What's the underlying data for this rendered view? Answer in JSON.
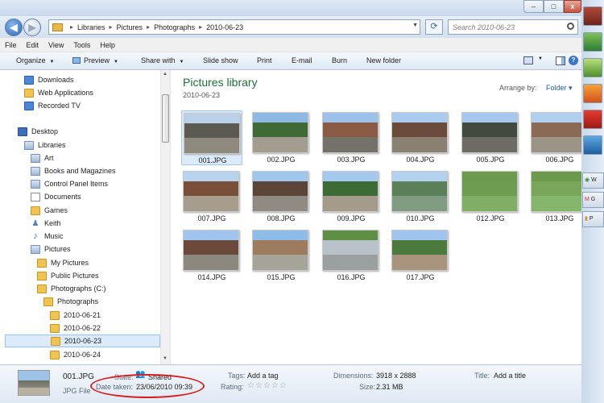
{
  "window": {
    "minimize": "–",
    "maximize": "□",
    "close": "x"
  },
  "address": {
    "crumbs": [
      "Libraries",
      "Pictures",
      "Photographs",
      "2010-06-23"
    ],
    "search_placeholder": "Search 2010-06-23"
  },
  "menu": [
    "File",
    "Edit",
    "View",
    "Tools",
    "Help"
  ],
  "toolbar": {
    "organize": "Organize",
    "preview": "Preview",
    "share_with": "Share with",
    "slide_show": "Slide show",
    "print": "Print",
    "email": "E-mail",
    "burn": "Burn",
    "new_folder": "New folder"
  },
  "nav": [
    {
      "label": "Downloads",
      "icon": "downloads-icon",
      "indent": 1
    },
    {
      "label": "Web Applications",
      "icon": "folder-icon",
      "indent": 1
    },
    {
      "label": "Recorded TV",
      "icon": "tv-icon",
      "indent": 1
    },
    {
      "label": "Desktop",
      "icon": "desktop-icon",
      "indent": 0
    },
    {
      "label": "Libraries",
      "icon": "library-icon",
      "indent": 1
    },
    {
      "label": "Art",
      "icon": "art-icon",
      "indent": 2
    },
    {
      "label": "Books and Magazines",
      "icon": "library-icon",
      "indent": 2
    },
    {
      "label": "Control Panel Items",
      "icon": "library-icon",
      "indent": 2
    },
    {
      "label": "Documents",
      "icon": "documents-icon",
      "indent": 2
    },
    {
      "label": "Games",
      "icon": "games-icon",
      "indent": 2
    },
    {
      "label": "Keith",
      "icon": "user-icon",
      "indent": 2
    },
    {
      "label": "Music",
      "icon": "music-icon",
      "indent": 2
    },
    {
      "label": "Pictures",
      "icon": "library-icon",
      "indent": 2
    },
    {
      "label": "My Pictures",
      "icon": "folder-icon",
      "indent": 3
    },
    {
      "label": "Public Pictures",
      "icon": "folder-icon",
      "indent": 3
    },
    {
      "label": "Photographs (C:)",
      "icon": "folder-icon",
      "indent": 3
    },
    {
      "label": "Photographs",
      "icon": "folder-icon",
      "indent": 4
    },
    {
      "label": "2010-06-21",
      "icon": "folder-icon",
      "indent": 5
    },
    {
      "label": "2010-06-22",
      "icon": "folder-icon",
      "indent": 5
    },
    {
      "label": "2010-06-23",
      "icon": "folder-icon",
      "indent": 5,
      "selected": true
    },
    {
      "label": "2010-06-24",
      "icon": "folder-icon",
      "indent": 5
    }
  ],
  "library": {
    "title": "Pictures library",
    "subtitle": "2010-06-23",
    "arrange_label": "Arrange by:",
    "arrange_value": "Folder"
  },
  "photos": [
    {
      "name": "001.JPG",
      "selected": true,
      "sky": "#b9d2ea",
      "bld": "#5c5a50",
      "grd": "#8f8a7e"
    },
    {
      "name": "002.JPG",
      "sky": "#8fb8e2",
      "bld": "#3f6a35",
      "grd": "#a39d90"
    },
    {
      "name": "003.JPG",
      "sky": "#9cc2ea",
      "bld": "#8a5a45",
      "grd": "#74716a"
    },
    {
      "name": "004.JPG",
      "sky": "#a9cbee",
      "bld": "#6a4a3a",
      "grd": "#8b8172"
    },
    {
      "name": "005.JPG",
      "sky": "#a6c8ec",
      "bld": "#42493d",
      "grd": "#6e6b63"
    },
    {
      "name": "006.JPG",
      "sky": "#b1d0ef",
      "bld": "#8b6a55",
      "grd": "#9b9587"
    },
    {
      "name": "007.JPG",
      "sky": "#b8d3ee",
      "bld": "#7a4f3a",
      "grd": "#a79d8d"
    },
    {
      "name": "008.JPG",
      "sky": "#9fc6ec",
      "bld": "#5a4536",
      "grd": "#8f8b83"
    },
    {
      "name": "009.JPG",
      "sky": "#a3c9ef",
      "bld": "#3d6b35",
      "grd": "#a49b8b"
    },
    {
      "name": "010.JPG",
      "sky": "#b3d2ef",
      "bld": "#5b7f56",
      "grd": "#7f9c82"
    },
    {
      "name": "012.JPG",
      "sky": "#6d9b4d",
      "bld": "#6e9c50",
      "grd": "#7fae64"
    },
    {
      "name": "013.JPG",
      "sky": "#6a9a4a",
      "bld": "#79a65a",
      "grd": "#86b56c"
    },
    {
      "name": "014.JPG",
      "sky": "#9fc5ee",
      "bld": "#6b4a3c",
      "grd": "#8d887d"
    },
    {
      "name": "015.JPG",
      "sky": "#8ebce9",
      "bld": "#9c7b5f",
      "grd": "#a6a398"
    },
    {
      "name": "016.JPG",
      "sky": "#5f8f45",
      "bld": "#b9c2c9",
      "grd": "#9aa0a0"
    },
    {
      "name": "017.JPG",
      "sky": "#9fc5ee",
      "bld": "#4b7a3c",
      "grd": "#a8947d"
    }
  ],
  "details": {
    "filename": "001.JPG",
    "filetype": "JPG File",
    "state_label": "State:",
    "state_value": "Shared",
    "date_label": "Date taken:",
    "date_value": "23/06/2010 09:39",
    "tags_label": "Tags:",
    "tags_value": "Add a tag",
    "rating_label": "Rating:",
    "rating_stars": "☆☆☆☆☆",
    "dimensions_label": "Dimensions:",
    "dimensions_value": "3918 x 2888",
    "size_label": "Size:",
    "size_value": "2.31 MB",
    "title_label": "Title:",
    "title_value": "Add a title"
  },
  "taskbar": {
    "tasks": [
      "W",
      "G",
      "P"
    ]
  }
}
